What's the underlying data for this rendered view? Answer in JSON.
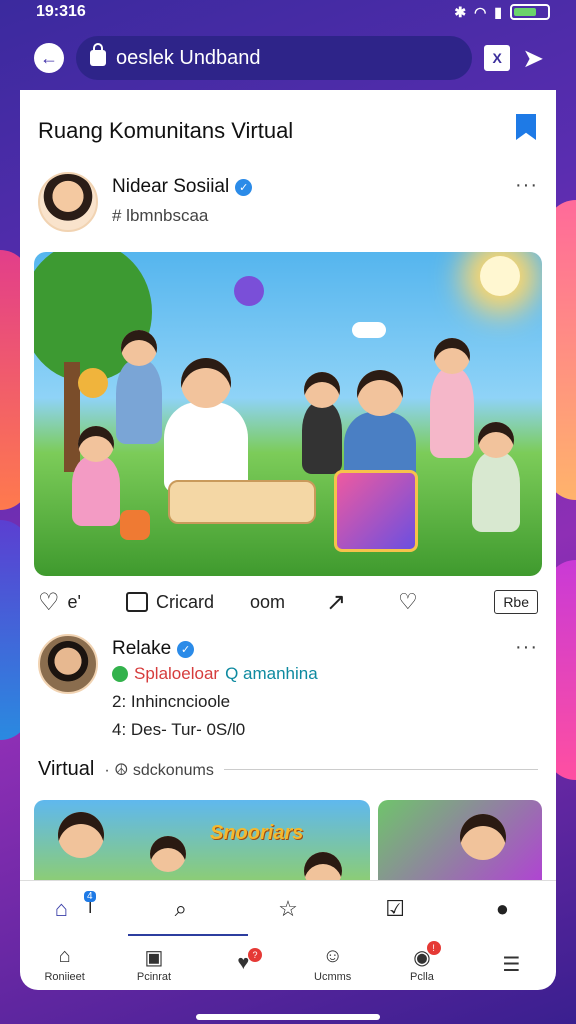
{
  "status_bar": {
    "time": "19:316"
  },
  "browser": {
    "url": "oeslek Undband",
    "tab_label": "X"
  },
  "page": {
    "title": "Ruang Komunitans Virtual"
  },
  "post": {
    "author": "Nidear Sosiial",
    "handle": "# lbmnbscaa",
    "actions": {
      "like_count": "e'",
      "comment_label": "Cricard",
      "share_label": "oom",
      "save_label": "Rbe"
    }
  },
  "comment": {
    "author": "Relake",
    "line_red": "Splaloeloar",
    "line_teal": "Q amanhina",
    "item_2": "2:  Inhincncioole",
    "item_4": "4:  Des- Tur- 0S/l0"
  },
  "section": {
    "title": "Virtual",
    "subtitle": "· ☮ sdckonums"
  },
  "thumbs": {
    "title": "Snooriars"
  },
  "tab_bar": {
    "home_badge": "4",
    "tab2_text": "I"
  },
  "nav": {
    "items": [
      {
        "label": "Roniieet",
        "icon": "house-icon"
      },
      {
        "label": "Pcinrat",
        "icon": "book-icon"
      },
      {
        "label": "",
        "icon": "heart-badge-icon",
        "badge": "?"
      },
      {
        "label": "Ucmms",
        "icon": "smiley-icon"
      },
      {
        "label": "Pclla",
        "icon": "palette-icon",
        "badge": "!"
      },
      {
        "label": "",
        "icon": "menu-icon"
      }
    ]
  },
  "colors": {
    "accent": "#4030a8",
    "verified": "#2b8be8",
    "bookmark": "#1e7ae6"
  }
}
